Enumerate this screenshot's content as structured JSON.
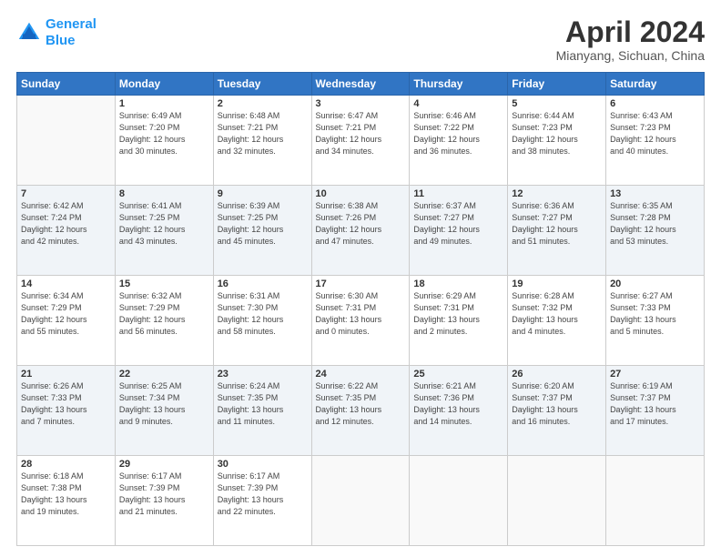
{
  "logo": {
    "line1": "General",
    "line2": "Blue"
  },
  "title": "April 2024",
  "location": "Mianyang, Sichuan, China",
  "days_of_week": [
    "Sunday",
    "Monday",
    "Tuesday",
    "Wednesday",
    "Thursday",
    "Friday",
    "Saturday"
  ],
  "weeks": [
    [
      {
        "day": "",
        "sunrise": "",
        "sunset": "",
        "daylight": ""
      },
      {
        "day": "1",
        "sunrise": "Sunrise: 6:49 AM",
        "sunset": "Sunset: 7:20 PM",
        "daylight": "Daylight: 12 hours and 30 minutes."
      },
      {
        "day": "2",
        "sunrise": "Sunrise: 6:48 AM",
        "sunset": "Sunset: 7:21 PM",
        "daylight": "Daylight: 12 hours and 32 minutes."
      },
      {
        "day": "3",
        "sunrise": "Sunrise: 6:47 AM",
        "sunset": "Sunset: 7:21 PM",
        "daylight": "Daylight: 12 hours and 34 minutes."
      },
      {
        "day": "4",
        "sunrise": "Sunrise: 6:46 AM",
        "sunset": "Sunset: 7:22 PM",
        "daylight": "Daylight: 12 hours and 36 minutes."
      },
      {
        "day": "5",
        "sunrise": "Sunrise: 6:44 AM",
        "sunset": "Sunset: 7:23 PM",
        "daylight": "Daylight: 12 hours and 38 minutes."
      },
      {
        "day": "6",
        "sunrise": "Sunrise: 6:43 AM",
        "sunset": "Sunset: 7:23 PM",
        "daylight": "Daylight: 12 hours and 40 minutes."
      }
    ],
    [
      {
        "day": "7",
        "sunrise": "Sunrise: 6:42 AM",
        "sunset": "Sunset: 7:24 PM",
        "daylight": "Daylight: 12 hours and 42 minutes."
      },
      {
        "day": "8",
        "sunrise": "Sunrise: 6:41 AM",
        "sunset": "Sunset: 7:25 PM",
        "daylight": "Daylight: 12 hours and 43 minutes."
      },
      {
        "day": "9",
        "sunrise": "Sunrise: 6:39 AM",
        "sunset": "Sunset: 7:25 PM",
        "daylight": "Daylight: 12 hours and 45 minutes."
      },
      {
        "day": "10",
        "sunrise": "Sunrise: 6:38 AM",
        "sunset": "Sunset: 7:26 PM",
        "daylight": "Daylight: 12 hours and 47 minutes."
      },
      {
        "day": "11",
        "sunrise": "Sunrise: 6:37 AM",
        "sunset": "Sunset: 7:27 PM",
        "daylight": "Daylight: 12 hours and 49 minutes."
      },
      {
        "day": "12",
        "sunrise": "Sunrise: 6:36 AM",
        "sunset": "Sunset: 7:27 PM",
        "daylight": "Daylight: 12 hours and 51 minutes."
      },
      {
        "day": "13",
        "sunrise": "Sunrise: 6:35 AM",
        "sunset": "Sunset: 7:28 PM",
        "daylight": "Daylight: 12 hours and 53 minutes."
      }
    ],
    [
      {
        "day": "14",
        "sunrise": "Sunrise: 6:34 AM",
        "sunset": "Sunset: 7:29 PM",
        "daylight": "Daylight: 12 hours and 55 minutes."
      },
      {
        "day": "15",
        "sunrise": "Sunrise: 6:32 AM",
        "sunset": "Sunset: 7:29 PM",
        "daylight": "Daylight: 12 hours and 56 minutes."
      },
      {
        "day": "16",
        "sunrise": "Sunrise: 6:31 AM",
        "sunset": "Sunset: 7:30 PM",
        "daylight": "Daylight: 12 hours and 58 minutes."
      },
      {
        "day": "17",
        "sunrise": "Sunrise: 6:30 AM",
        "sunset": "Sunset: 7:31 PM",
        "daylight": "Daylight: 13 hours and 0 minutes."
      },
      {
        "day": "18",
        "sunrise": "Sunrise: 6:29 AM",
        "sunset": "Sunset: 7:31 PM",
        "daylight": "Daylight: 13 hours and 2 minutes."
      },
      {
        "day": "19",
        "sunrise": "Sunrise: 6:28 AM",
        "sunset": "Sunset: 7:32 PM",
        "daylight": "Daylight: 13 hours and 4 minutes."
      },
      {
        "day": "20",
        "sunrise": "Sunrise: 6:27 AM",
        "sunset": "Sunset: 7:33 PM",
        "daylight": "Daylight: 13 hours and 5 minutes."
      }
    ],
    [
      {
        "day": "21",
        "sunrise": "Sunrise: 6:26 AM",
        "sunset": "Sunset: 7:33 PM",
        "daylight": "Daylight: 13 hours and 7 minutes."
      },
      {
        "day": "22",
        "sunrise": "Sunrise: 6:25 AM",
        "sunset": "Sunset: 7:34 PM",
        "daylight": "Daylight: 13 hours and 9 minutes."
      },
      {
        "day": "23",
        "sunrise": "Sunrise: 6:24 AM",
        "sunset": "Sunset: 7:35 PM",
        "daylight": "Daylight: 13 hours and 11 minutes."
      },
      {
        "day": "24",
        "sunrise": "Sunrise: 6:22 AM",
        "sunset": "Sunset: 7:35 PM",
        "daylight": "Daylight: 13 hours and 12 minutes."
      },
      {
        "day": "25",
        "sunrise": "Sunrise: 6:21 AM",
        "sunset": "Sunset: 7:36 PM",
        "daylight": "Daylight: 13 hours and 14 minutes."
      },
      {
        "day": "26",
        "sunrise": "Sunrise: 6:20 AM",
        "sunset": "Sunset: 7:37 PM",
        "daylight": "Daylight: 13 hours and 16 minutes."
      },
      {
        "day": "27",
        "sunrise": "Sunrise: 6:19 AM",
        "sunset": "Sunset: 7:37 PM",
        "daylight": "Daylight: 13 hours and 17 minutes."
      }
    ],
    [
      {
        "day": "28",
        "sunrise": "Sunrise: 6:18 AM",
        "sunset": "Sunset: 7:38 PM",
        "daylight": "Daylight: 13 hours and 19 minutes."
      },
      {
        "day": "29",
        "sunrise": "Sunrise: 6:17 AM",
        "sunset": "Sunset: 7:39 PM",
        "daylight": "Daylight: 13 hours and 21 minutes."
      },
      {
        "day": "30",
        "sunrise": "Sunrise: 6:17 AM",
        "sunset": "Sunset: 7:39 PM",
        "daylight": "Daylight: 13 hours and 22 minutes."
      },
      {
        "day": "",
        "sunrise": "",
        "sunset": "",
        "daylight": ""
      },
      {
        "day": "",
        "sunrise": "",
        "sunset": "",
        "daylight": ""
      },
      {
        "day": "",
        "sunrise": "",
        "sunset": "",
        "daylight": ""
      },
      {
        "day": "",
        "sunrise": "",
        "sunset": "",
        "daylight": ""
      }
    ]
  ]
}
